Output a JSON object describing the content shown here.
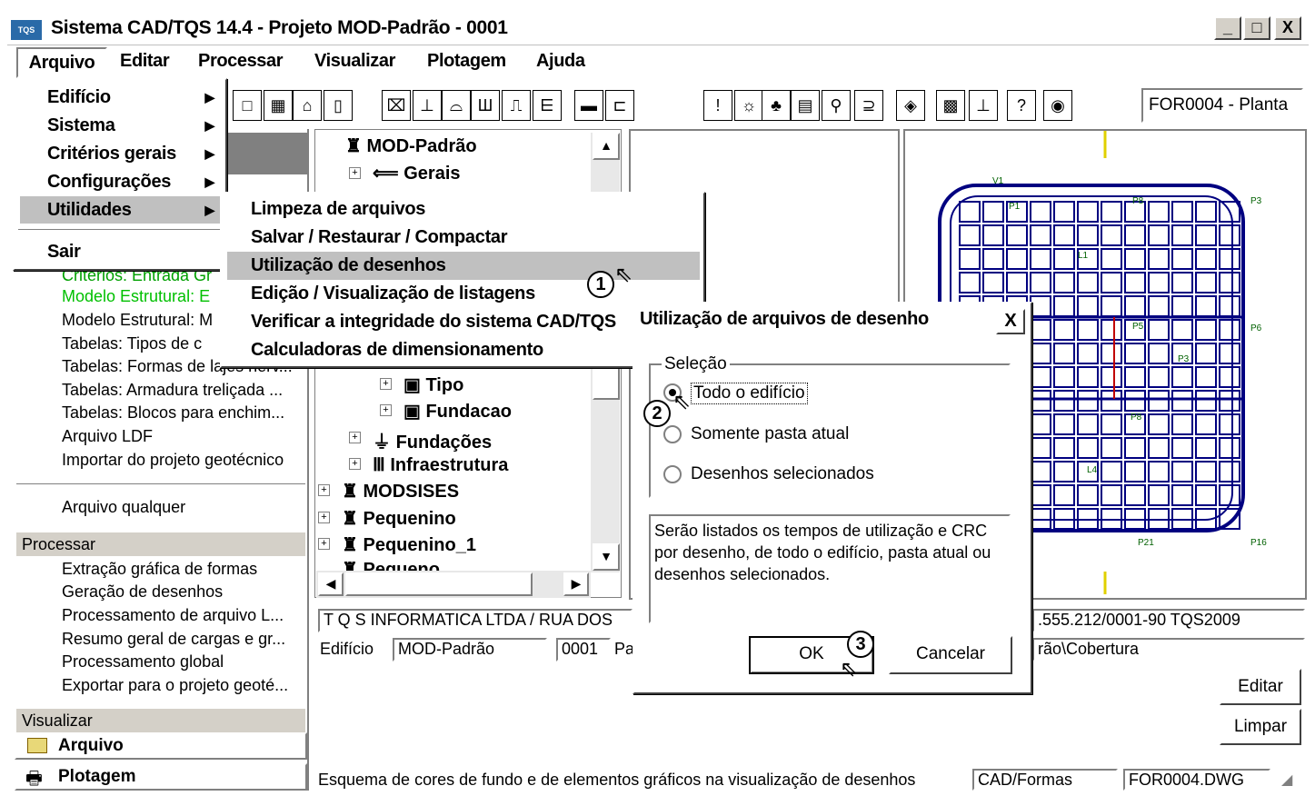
{
  "window": {
    "title": "Sistema CAD/TQS 14.4 - Projeto MOD-Padrão - 0001",
    "logo": "TQS",
    "min": "_",
    "max": "□",
    "close": "X"
  },
  "menubar": [
    "Arquivo",
    "Editar",
    "Processar",
    "Visualizar",
    "Plotagem",
    "Ajuda"
  ],
  "dropdown": [
    "Edifício",
    "Sistema",
    "Critérios gerais",
    "Configurações",
    "Utilidades",
    "Sair"
  ],
  "submenu": [
    "Limpeza de arquivos",
    "Salvar / Restaurar / Compactar",
    "Utilização de desenhos",
    "Edição / Visualização de listagens",
    "Verificar a integridade do sistema CAD/TQS",
    "Calculadoras de dimensionamento"
  ],
  "toolbar": {
    "plant_field": "FOR0004 - Planta"
  },
  "leftpane": {
    "items_top": [
      "Critérios: Entrada Gr",
      "Modelo Estrutural: E",
      "Modelo Estrutural: M",
      "Tabelas: Tipos de c",
      "Tabelas: Formas de lajes nerv...",
      "Tabelas: Armadura treliçada ...",
      "Tabelas: Blocos para enchim...",
      "Arquivo LDF",
      "Importar do projeto geotécnico",
      "Arquivo qualquer"
    ],
    "processar_header": "Processar",
    "processar_items": [
      "Extração gráfica de formas",
      "Geração de desenhos",
      "Processamento de arquivo L...",
      "Resumo geral de cargas e gr...",
      "Processamento global",
      "Exportar para o projeto geoté..."
    ],
    "visualizar_header": "Visualizar",
    "bottom_buttons": [
      "Arquivo",
      "Plotagem"
    ]
  },
  "tree": {
    "nodes": [
      "MOD-Padrão",
      "Gerais",
      "Tipo",
      "Fundacao",
      "Fundações",
      "Infraestrutura",
      "MODSISES",
      "Pequenino",
      "Pequenino_1",
      "Pequeno"
    ]
  },
  "dialog": {
    "title": "Utilização de arquivos de desenho",
    "close": "X",
    "group_label": "Seleção",
    "options": [
      "Todo o edifício",
      "Somente pasta atual",
      "Desenhos selecionados"
    ],
    "description": "Serão listados os tempos de utilização e CRC por desenho, de todo o edifício, pasta atual ou desenhos selecionados.",
    "ok": "OK",
    "cancel": "Cancelar"
  },
  "callouts": [
    "1",
    "2",
    "3"
  ],
  "status": {
    "company_left": "T Q S  INFORMATICA LTDA / RUA DOS",
    "company_right": ".555.212/0001-90 TQS2009",
    "edificio_label": "Edifício",
    "edificio_value": "MOD-Padrão",
    "pavimento_num": "0001",
    "pa_label": "Pa",
    "path": "rão\\Cobertura",
    "editar": "Editar",
    "limpar": "Limpar",
    "bottom_text": "Esquema de cores de fundo e de elementos gráficos na visualização de desenhos",
    "bottom_field1": "CAD/Formas",
    "bottom_field2": "FOR0004.DWG"
  },
  "drawing_labels": [
    "V1",
    "P1",
    "P8",
    "P3",
    "L1",
    "P5",
    "P6",
    "P3",
    "L4",
    "P8",
    "P21",
    "P16"
  ]
}
